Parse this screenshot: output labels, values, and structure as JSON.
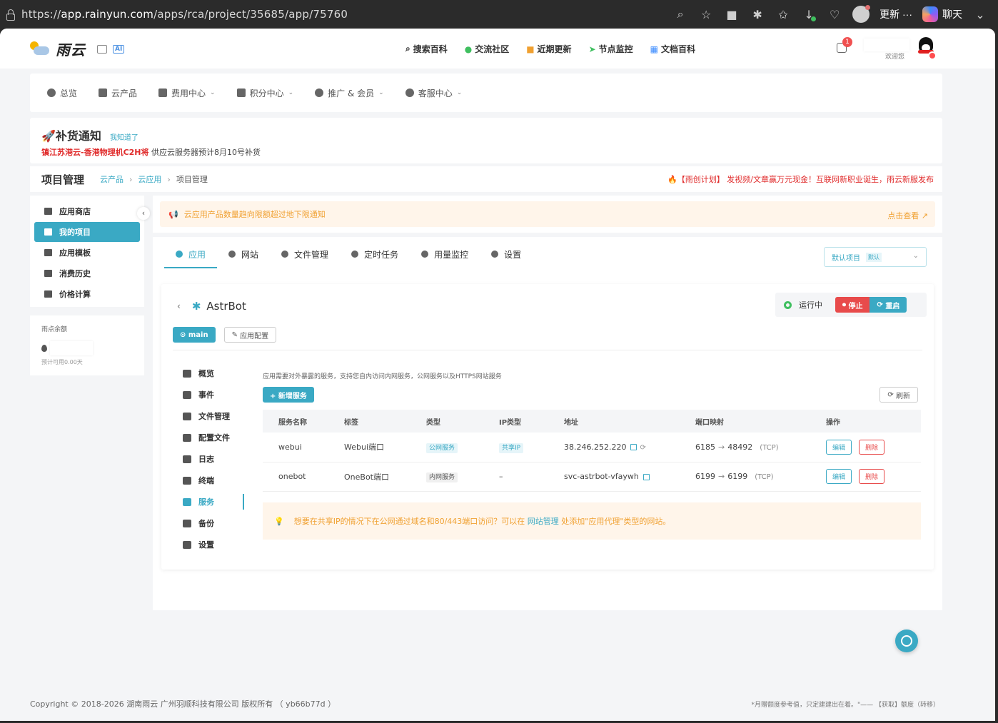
{
  "browser": {
    "url_prefix": "https://",
    "url_host": "app.rainyun.com",
    "url_path": "/apps/rca/project/35685/app/75760",
    "update_label": "更新",
    "chat_label": "聊天"
  },
  "header": {
    "logo_text": "雨云",
    "ai_label": "AI",
    "links": [
      "搜索百科",
      "交流社区",
      "近期更新",
      "节点监控",
      "文档百科"
    ],
    "notify_count": "1",
    "welcome": "欢迎您"
  },
  "menu": {
    "items": [
      "总览",
      "云产品",
      "费用中心",
      "积分中心",
      "推广 & 会员",
      "客服中心"
    ]
  },
  "notice": {
    "title": "补货通知",
    "ack": "我知道了",
    "highlight": "镇江苏港云-香港物理机C2H将",
    "body": "供应云服务器预计8月10号补货"
  },
  "breadcrumb": {
    "title": "项目管理",
    "items": [
      "云产品",
      "云应用",
      "项目管理"
    ],
    "promo": "🔥【雨创计划】 发视频/文章赢万元现金！互联网新职业诞生，雨云新服发布"
  },
  "sidebar": {
    "items": [
      "应用商店",
      "我的项目",
      "应用模板",
      "消费历史",
      "价格计算"
    ],
    "balance_title": "雨点余额",
    "balance_note": "预计可用0.00天"
  },
  "alert": {
    "text": "云应用产品数量趋向限额超过地下限通知",
    "link": "点击查看"
  },
  "tabs": [
    "应用",
    "网站",
    "文件管理",
    "定时任务",
    "用量监控",
    "设置"
  ],
  "project_select": {
    "label": "默认项目",
    "tag": "默认"
  },
  "app": {
    "name": "AstrBot",
    "status": "运行中",
    "stop_label": "停止",
    "restart_label": "重启",
    "branch": "main",
    "config_label": "应用配置"
  },
  "subnav": [
    "概览",
    "事件",
    "文件管理",
    "配置文件",
    "日志",
    "终端",
    "服务",
    "备份",
    "设置"
  ],
  "services": {
    "description": "应用需要对外暴露的服务，支持您自内访问内网服务，公网服务以及HTTPS网站服务",
    "add_label": "+ 新增服务",
    "refresh_label": "刷新",
    "columns": [
      "服务名称",
      "标签",
      "类型",
      "IP类型",
      "地址",
      "端口映射",
      "操作"
    ],
    "rows": [
      {
        "name": "webui",
        "label": "Webui端口",
        "type": "公网服务",
        "ip_type": "共享IP",
        "address": "38.246.252.220",
        "port_from": "6185",
        "port_to": "48492",
        "proto": "(TCP)",
        "edit": "编辑",
        "delete": "删除"
      },
      {
        "name": "onebot",
        "label": "OneBot端口",
        "type": "内网服务",
        "ip_type": "–",
        "address": "svc-astrbot-vfaywh",
        "port_from": "6199",
        "port_to": "6199",
        "proto": "(TCP)",
        "edit": "编辑",
        "delete": "删除"
      }
    ],
    "tip_before": "想要在共享IP的情况下在公网通过域名和80/443端口访问？可以在",
    "tip_link": "网站管理",
    "tip_after": "处添加\"应用代理\"类型的网站。"
  },
  "footer": {
    "left": "Copyright © 2018-2026 湖南雨云 广州羽顺科技有限公司 版权所有 （ yb66b77d ）",
    "right": "*月赠额度参考值，只定建建出在着。\"—— 【获取】额度（转移）"
  },
  "colors": {
    "accent": "#3aa9c4",
    "danger": "#e84b4b",
    "warning": "#f0a030",
    "success": "#3fbf5f"
  }
}
